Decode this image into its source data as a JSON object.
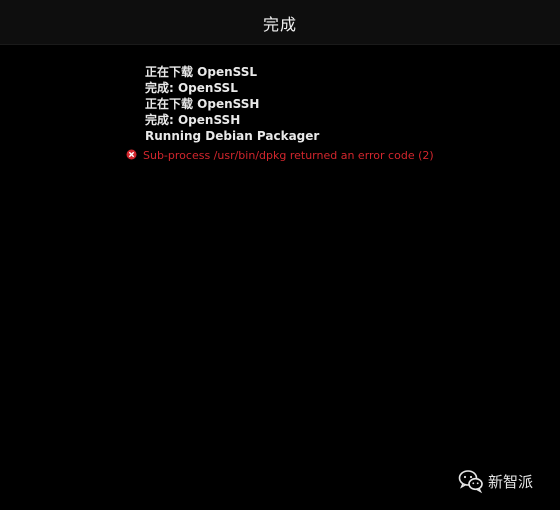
{
  "header": {
    "title": "完成"
  },
  "log": {
    "lines": [
      "正在下载 OpenSSL",
      "完成: OpenSSL",
      "正在下载 OpenSSH",
      "完成: OpenSSH",
      "Running Debian Packager"
    ],
    "error": {
      "icon": "error-x-icon",
      "text": "Sub-process /usr/bin/dpkg returned an error code (2)"
    }
  },
  "watermark": {
    "icon": "wechat-icon",
    "text": "新智派"
  },
  "colors": {
    "background": "#000000",
    "text": "#e9e9e9",
    "error": "#d2262d"
  }
}
